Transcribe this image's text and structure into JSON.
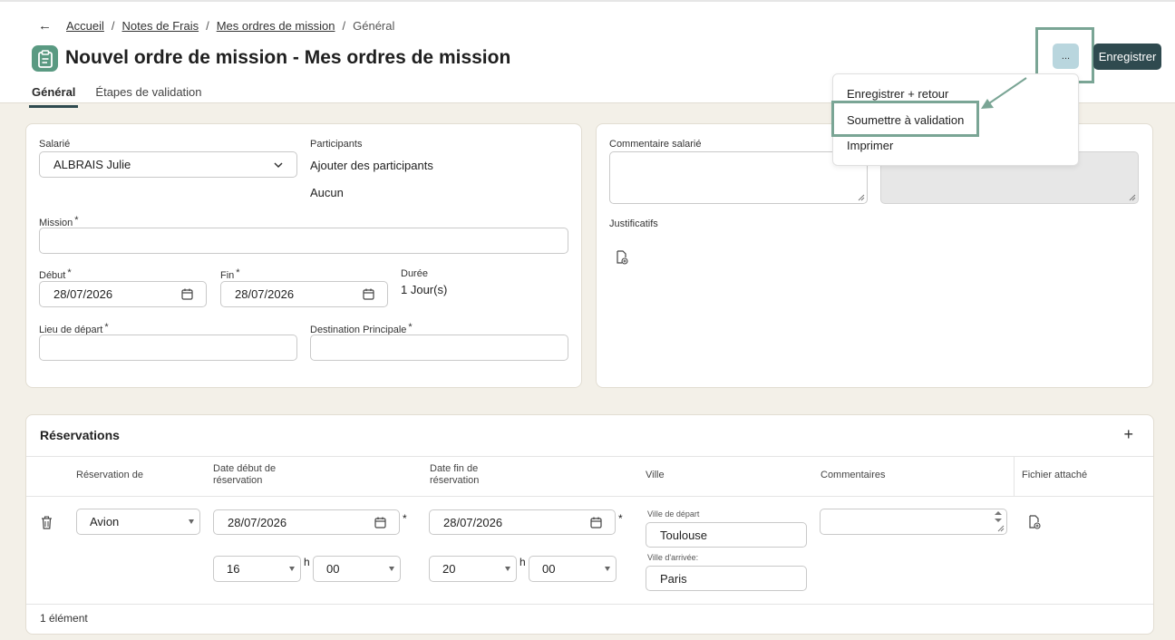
{
  "breadcrumb": {
    "back": "←",
    "items": [
      "Accueil",
      "Notes de Frais",
      "Mes ordres de mission"
    ],
    "current": "Général"
  },
  "page": {
    "title": "Nouvel ordre de mission - Mes ordres de mission"
  },
  "tabs": [
    "Général",
    "Étapes de validation"
  ],
  "toolbar": {
    "more_label": "...",
    "save_label": "Enregistrer"
  },
  "menu": {
    "items": [
      "Enregistrer + retour",
      "Soumettre à validation",
      "Imprimer"
    ]
  },
  "form": {
    "salarie_label": "Salarié",
    "salarie_value": "ALBRAIS Julie",
    "participants_label": "Participants",
    "participants_link": "Ajouter des participants",
    "participants_value": "Aucun",
    "mission_label": "Mission",
    "debut_label": "Début",
    "debut_value": "28/07/2026",
    "fin_label": "Fin",
    "fin_value": "28/07/2026",
    "duree_label": "Durée",
    "duree_value": "1 Jour(s)",
    "lieu_label": "Lieu de départ",
    "destination_label": "Destination Principale",
    "required_mark": "*"
  },
  "side": {
    "commentaire_label": "Commentaire salarié",
    "justificatifs_label": "Justificatifs"
  },
  "reservations": {
    "title": "Réservations",
    "add": "+",
    "columns": [
      "Réservation de",
      "Date début de réservation",
      "Date fin de réservation",
      "Ville",
      "Commentaires",
      "Fichier attaché"
    ],
    "row": {
      "type": "Avion",
      "start_date": "28/07/2026",
      "start_hour": "16",
      "start_min": "00",
      "end_date": "28/07/2026",
      "end_hour": "20",
      "end_min": "00",
      "h_label": "h",
      "depart_label": "Ville de départ",
      "depart_value": "Toulouse",
      "arrivee_label": "Ville d'arrivée:",
      "arrivee_value": "Paris"
    },
    "footer": "1 élément"
  },
  "colors": {
    "accent": "#2f4a4f",
    "highlight": "#7aa595",
    "more_button": "#b9d6de",
    "app_icon": "#5a9a82"
  }
}
